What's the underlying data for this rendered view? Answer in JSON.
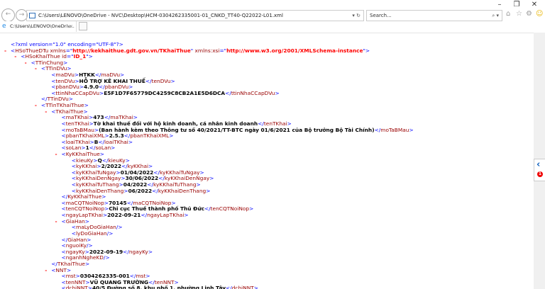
{
  "window": {
    "minimize": "–",
    "restore": "❐",
    "close": "✕"
  },
  "toolbar": {
    "back_icon": "back-arrow",
    "forward_icon": "forward-arrow",
    "address": "C:\\Users\\LENOVO\\OneDrive - NVC\\Desktop\\HCM-0304262335001-01_CNKD_TT40-Q22022-L01.xml",
    "search_placeholder": "Search...",
    "search_glyph": "⌕ ▾",
    "address_glyph": "▾ ↻",
    "icons": [
      "home-icon",
      "star-icon",
      "gear-icon",
      "smiley-icon"
    ]
  },
  "tab": {
    "label": "C:\\Users\\LENOVO\\OneDriv...",
    "close": "×"
  },
  "side_panel": {
    "chevron": "‹",
    "badge": "1"
  },
  "colors": {
    "bracket": "#0000ff",
    "tag": "#990000",
    "attr_value": "#ff0000",
    "fold": "#ff0000"
  },
  "xml_lines": [
    {
      "d": 0,
      "pi": "<?xml version=\"1.0\" encoding=\"UTF-8\"?>"
    },
    {
      "d": 0,
      "f": true,
      "tag": "HSoThueDTu",
      "attrs": [
        [
          "xmlns",
          "http://kekhaithue.gdt.gov.vn/TKhaiThue"
        ],
        [
          "xmlns:xsi",
          "http://www.w3.org/2001/XMLSchema-instance"
        ]
      ]
    },
    {
      "d": 1,
      "f": true,
      "tag": "HSoKhaiThue",
      "attrs": [
        [
          "id",
          "ID_1"
        ]
      ]
    },
    {
      "d": 2,
      "f": true,
      "tag": "TTinChung"
    },
    {
      "d": 3,
      "f": true,
      "tag": "TTinDVu"
    },
    {
      "d": 4,
      "tag": "maDVu",
      "text": "HTKK"
    },
    {
      "d": 4,
      "tag": "tenDVu",
      "text": "HỖ TRỢ KÊ KHAI THUẾ"
    },
    {
      "d": 4,
      "tag": "pbanDVu",
      "text": "4.9.0"
    },
    {
      "d": 4,
      "tag": "ttinNhaCCapDVu",
      "text": "E5F1D7F65779DC4259C8CB2A1E5D6DCA"
    },
    {
      "d": 3,
      "close": "TTinDVu"
    },
    {
      "d": 3,
      "f": true,
      "tag": "TTinTKhaiThue"
    },
    {
      "d": 4,
      "f": true,
      "tag": "TKhaiThue"
    },
    {
      "d": 5,
      "tag": "maTKhai",
      "text": "473"
    },
    {
      "d": 5,
      "tag": "tenTKhai",
      "text": "Tờ khai thuế đối với hộ kinh doanh, cá nhân kinh doanh"
    },
    {
      "d": 5,
      "tag": "moTaBMau",
      "text": "(Ban hành kèm theo Thông tư số 40/2021/TT-BTC ngày 01/6/2021 của Bộ trưởng Bộ Tài Chính)"
    },
    {
      "d": 5,
      "tag": "pbanTKhaiXML",
      "text": "2.5.3"
    },
    {
      "d": 5,
      "tag": "loaiTKhai",
      "text": "B"
    },
    {
      "d": 5,
      "tag": "soLan",
      "text": "1"
    },
    {
      "d": 5,
      "f": true,
      "tag": "KyKKhaiThue"
    },
    {
      "d": 6,
      "tag": "kieuKy",
      "text": "Q"
    },
    {
      "d": 6,
      "tag": "kyKKhai",
      "text": "2/2022"
    },
    {
      "d": 6,
      "tag": "kyKKhaiTuNgay",
      "text": "01/04/2022"
    },
    {
      "d": 6,
      "tag": "kyKKhaiDenNgay",
      "text": "30/06/2022"
    },
    {
      "d": 6,
      "tag": "kyKKhaiTuThang",
      "text": "04/2022"
    },
    {
      "d": 6,
      "tag": "kyKKhaiDenThang",
      "text": "06/2022"
    },
    {
      "d": 5,
      "close": "KyKKhaiThue"
    },
    {
      "d": 5,
      "tag": "maCQTNoiNop",
      "text": "70145"
    },
    {
      "d": 5,
      "tag": "tenCQTNoiNop",
      "text": "Chi cục Thuế thành phố Thủ Đức"
    },
    {
      "d": 5,
      "tag": "ngayLapTKhai",
      "text": "2022-09-21"
    },
    {
      "d": 5,
      "f": true,
      "tag": "GiaHan"
    },
    {
      "d": 6,
      "self": "maLyDoGiaHan"
    },
    {
      "d": 6,
      "self": "lyDoGiaHan"
    },
    {
      "d": 5,
      "close": "GiaHan"
    },
    {
      "d": 5,
      "self": "nguoiKy"
    },
    {
      "d": 5,
      "tag": "ngayKy",
      "text": "2022-09-19"
    },
    {
      "d": 5,
      "self": "nganhNgheKD"
    },
    {
      "d": 4,
      "close": "TKhaiThue"
    },
    {
      "d": 4,
      "f": true,
      "tag": "NNT"
    },
    {
      "d": 5,
      "tag": "mst",
      "text": "0304262335-001"
    },
    {
      "d": 5,
      "tag": "tenNNT",
      "text": "VŨ QUANG TRƯỜNG"
    },
    {
      "d": 5,
      "tag": "dchiNNT",
      "text": "40/5 Đường số 8, khu phố 1, phường Linh Tây"
    }
  ]
}
